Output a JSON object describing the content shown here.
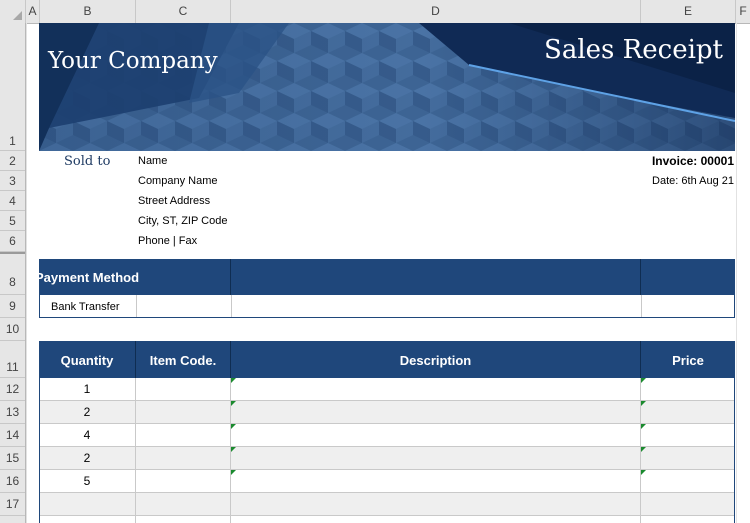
{
  "columns": [
    "A",
    "B",
    "C",
    "D",
    "E",
    "F"
  ],
  "rows": [
    "1",
    "2",
    "3",
    "4",
    "5",
    "6",
    "8",
    "9",
    "10",
    "11",
    "12",
    "13",
    "14",
    "15",
    "16",
    "17"
  ],
  "banner": {
    "company": "Your Company",
    "title": "Sales Receipt"
  },
  "sold_to": {
    "label": "Sold to",
    "lines": [
      "Name",
      "Company Name",
      "Street Address",
      "City, ST,  ZIP Code",
      "Phone | Fax"
    ]
  },
  "invoice": {
    "number": "Invoice: 00001",
    "date": "Date: 6th Aug 21"
  },
  "payment": {
    "header": "Payment Method",
    "value": "Bank Transfer"
  },
  "items_table": {
    "headers": [
      "Quantity",
      "Item Code.",
      "Description",
      "Price"
    ],
    "quantities": [
      "1",
      "2",
      "4",
      "2",
      "5",
      ""
    ]
  },
  "colors": {
    "header_fill": "#1f477b",
    "banner_fill": "#3b5f8e",
    "alt_row": "#efefef"
  }
}
